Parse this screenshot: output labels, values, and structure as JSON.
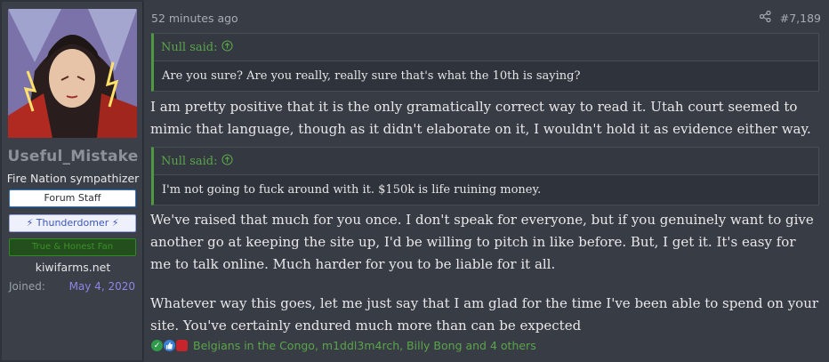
{
  "user": {
    "username": "Useful_Mistake",
    "title": "Fire Nation sympathizer",
    "banners": [
      "Forum Staff",
      "⚡ Thunderdomer ⚡",
      "True & Honest Fan"
    ],
    "site": "kiwifarms.net",
    "joined_label": "Joined:",
    "joined_value": "May 4, 2020"
  },
  "post": {
    "time": "52 minutes ago",
    "number": "#7,189",
    "quote1": {
      "author": "Null said:",
      "text": "Are you sure? Are you really, really sure that's what the 10th is saying?"
    },
    "para1": "I am pretty positive that it is the only gramatically correct way to read it. Utah court seemed to mimic that language, though as it didn't elaborate on it, I wouldn't hold it as evidence either way.",
    "quote2": {
      "author": "Null said:",
      "text": "I'm not going to fuck around with it. $150k is life ruining money."
    },
    "para2": "We've raised that much for you once. I don't speak for everyone, but if you genuinely want to give another go at keeping the site up, I'd be willing to pitch in like before. But, I get it. It's easy for me to talk online. Much harder for you to be liable for it all.",
    "para3": "Whatever way this goes, let me just say that I am glad for the time I've been able to spend on your site. You've certainly endured much more than can be expected",
    "reactions": "Belgians in the Congo, m1ddl3m4rch, Billy Bong and 4 others"
  },
  "colors": {
    "accent_green": "#5aa54a",
    "joined_purple": "#8e86e6"
  },
  "icons": [
    "share-icon",
    "arrow-up-icon",
    "checkmark-reaction-icon",
    "thumbs-up-reaction-icon",
    "red-reaction-icon"
  ]
}
